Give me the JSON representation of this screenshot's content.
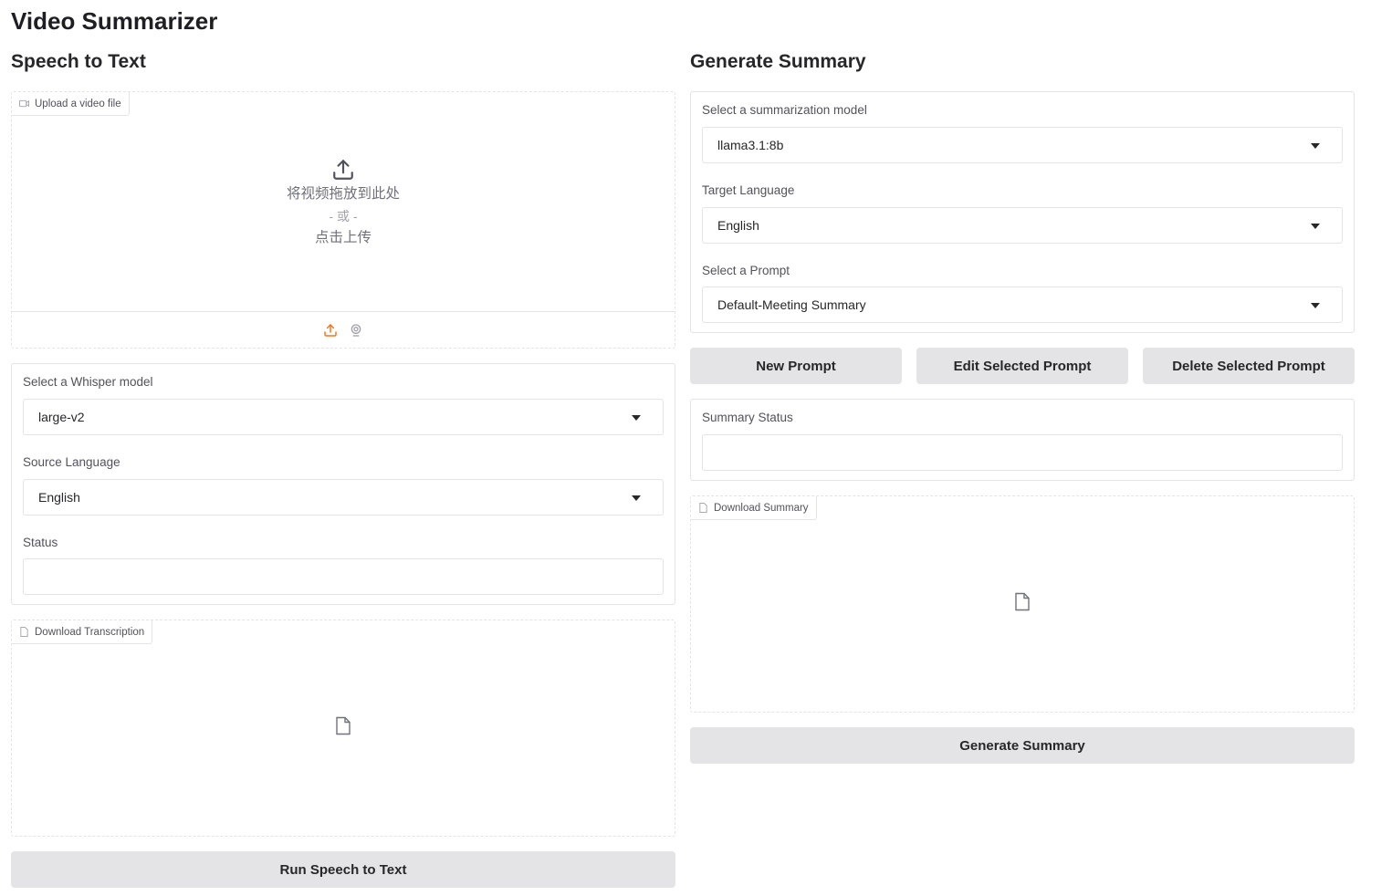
{
  "app": {
    "title": "Video Summarizer"
  },
  "left": {
    "title": "Speech to Text",
    "upload": {
      "tag": "Upload a video file",
      "drop_text": "将视频拖放到此处",
      "or_text": "- 或 -",
      "click_text": "点击上传",
      "icon": "upload-icon",
      "source_icons": [
        "upload-icon",
        "webcam-icon"
      ]
    },
    "whisper_label": "Select a Whisper model",
    "whisper_value": "large-v2",
    "source_lang_label": "Source Language",
    "source_lang_value": "English",
    "status_label": "Status",
    "status_value": "",
    "download_tag": "Download Transcription",
    "run_button": "Run Speech to Text"
  },
  "right": {
    "title": "Generate Summary",
    "model_label": "Select a summarization model",
    "model_value": "llama3.1:8b",
    "target_lang_label": "Target Language",
    "target_lang_value": "English",
    "prompt_label": "Select a Prompt",
    "prompt_value": "Default-Meeting Summary",
    "buttons": {
      "new_prompt": "New Prompt",
      "edit_prompt": "Edit Selected Prompt",
      "delete_prompt": "Delete Selected Prompt"
    },
    "summary_status_label": "Summary Status",
    "summary_status_value": "",
    "download_tag": "Download Summary",
    "generate_button": "Generate Summary"
  },
  "colors": {
    "accent": "#f97316",
    "button_bg": "#e4e4e7",
    "border": "#e4e4e7"
  }
}
